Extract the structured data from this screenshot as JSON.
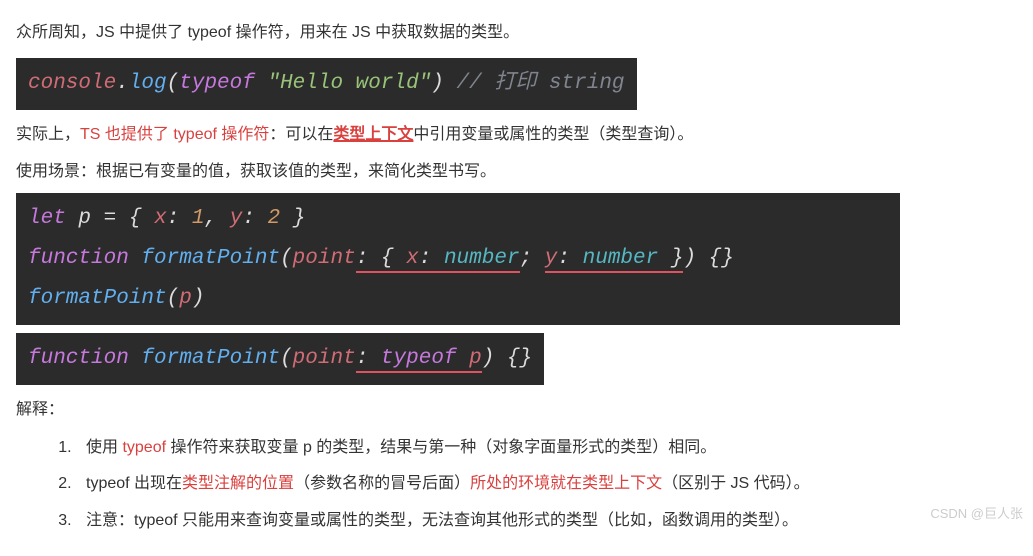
{
  "intro": {
    "t1_a": "众所周知，JS 中提供了 typeof 操作符，用来在 JS 中获取数据的类型。",
    "t2_a": "实际上，",
    "t2_b": "TS 也提供了 typeof 操作符",
    "t2_c": "：可以在",
    "t2_d": "类型上下文",
    "t2_e": "中引用变量或属性的类型（类型查询）。",
    "t3": "使用场景：根据已有变量的值，获取该值的类型，来简化类型书写。"
  },
  "code1": {
    "console": "console",
    "dot": ".",
    "log": "log",
    "lp": "(",
    "typeof": "typeof ",
    "str": "\"Hello world\"",
    "rp": ")",
    "comment": " // 打印 string"
  },
  "code2": {
    "let": "let",
    "p": " p ",
    "eq": "= ",
    "lb": "{ ",
    "xk": "x",
    "xc": ": ",
    "xv": "1",
    "comma": ", ",
    "yk": "y",
    "yc": ": ",
    "yv": "2",
    "rb": " }",
    "function": "function",
    "fname": " formatPoint",
    "lp": "(",
    "param": "point",
    "colon": ":",
    "sp": " ",
    "tlb": "{ ",
    "tx": "x",
    "txc": ": ",
    "txt": "number",
    "tcomma": "; ",
    "ty": "y",
    "tyc": ": ",
    "tyt": "number",
    "trb": " }",
    "rp": ") {}",
    "call_fn": "formatPoint",
    "call_lp": "(",
    "call_arg": "p",
    "call_rp": ")"
  },
  "code3": {
    "function": "function",
    "fname": " formatPoint",
    "lp": "(",
    "param": "point",
    "colon": ":",
    "sp": " ",
    "typeof": "typeof",
    "sp2": " ",
    "p": "p",
    "rp": ") {}"
  },
  "explain": {
    "title": "解释：",
    "l1_a": "使用 ",
    "l1_b": "typeof",
    "l1_c": " 操作符来获取变量 p 的类型，结果与第一种（对象字面量形式的类型）相同。",
    "l2_a": "typeof 出现在",
    "l2_b": "类型注解的位置",
    "l2_c": "（参数名称的冒号后面）",
    "l2_d": "所处的环境就在类型上下文",
    "l2_e": "（区别于 JS 代码）。",
    "l3": "注意：typeof 只能用来查询变量或属性的类型，无法查询其他形式的类型（比如，函数调用的类型）。"
  },
  "watermark": "CSDN @巨人张"
}
